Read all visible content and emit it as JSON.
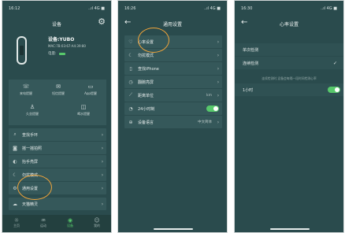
{
  "phone1": {
    "time": "16:12",
    "signal": "..ıl 4G ■",
    "title": "设备",
    "device_name": "设备:YUBO",
    "mac": "MAC:7B:03:67:A4:39:80",
    "battery_label": "电量:",
    "grid": [
      {
        "icon": "mail-icon",
        "label": "来电提醒"
      },
      {
        "icon": "message-icon",
        "label": "短信提醒"
      },
      {
        "icon": "app-icon",
        "label": "App提醒"
      },
      {
        "icon": "sedentary-icon",
        "label": "久坐提醒"
      },
      {
        "icon": "drink-icon",
        "label": "喝水提醒"
      }
    ],
    "list": [
      {
        "icon": "search-icon",
        "label": "查找手环"
      },
      {
        "icon": "camera-icon",
        "label": "摇一摇拍照"
      },
      {
        "icon": "wrist-icon",
        "label": "抬手亮屏"
      },
      {
        "icon": "moon-icon",
        "label": "勿扰模式"
      },
      {
        "icon": "gear-icon",
        "label": "通用设置"
      },
      {
        "icon": "weather-icon",
        "label": "天猫精灵"
      }
    ],
    "tabs": [
      {
        "icon": "activity-icon",
        "label": "主页"
      },
      {
        "icon": "sport-icon",
        "label": "运动"
      },
      {
        "icon": "device-icon",
        "label": "设备"
      },
      {
        "icon": "profile-icon",
        "label": "我的"
      }
    ]
  },
  "phone2": {
    "time": "16:26",
    "signal": "..ıl 4G ■",
    "title": "通用设置",
    "rows": [
      {
        "icon": "heart-icon",
        "label": "心率设置",
        "value": ""
      },
      {
        "icon": "moon-icon",
        "label": "勿扰模式",
        "value": ""
      },
      {
        "icon": "phone-icon",
        "label": "查找iPhone",
        "value": ""
      },
      {
        "icon": "dial-icon",
        "label": "翻腕亮屏",
        "value": ""
      },
      {
        "icon": "ruler-icon",
        "label": "距离单位",
        "value": "km"
      },
      {
        "icon": "clock-icon",
        "label": "24小时制",
        "value": ""
      },
      {
        "icon": "globe-icon",
        "label": "设备语言",
        "value": "中文简体"
      }
    ]
  },
  "phone3": {
    "time": "16:30",
    "signal": "..ıl 4G ■",
    "title": "心率设置",
    "options": [
      {
        "label": "单次检测",
        "checked": false
      },
      {
        "label": "连续检测",
        "checked": true
      }
    ],
    "tip": "连续检测时,设备会每隔一段时间检测心率",
    "interval_label": "1小时"
  },
  "colors": {
    "bg": "#2a4b4d",
    "row": "#35585a",
    "accent_circle": "#f0a43a",
    "toggle_on": "#57c86b"
  }
}
